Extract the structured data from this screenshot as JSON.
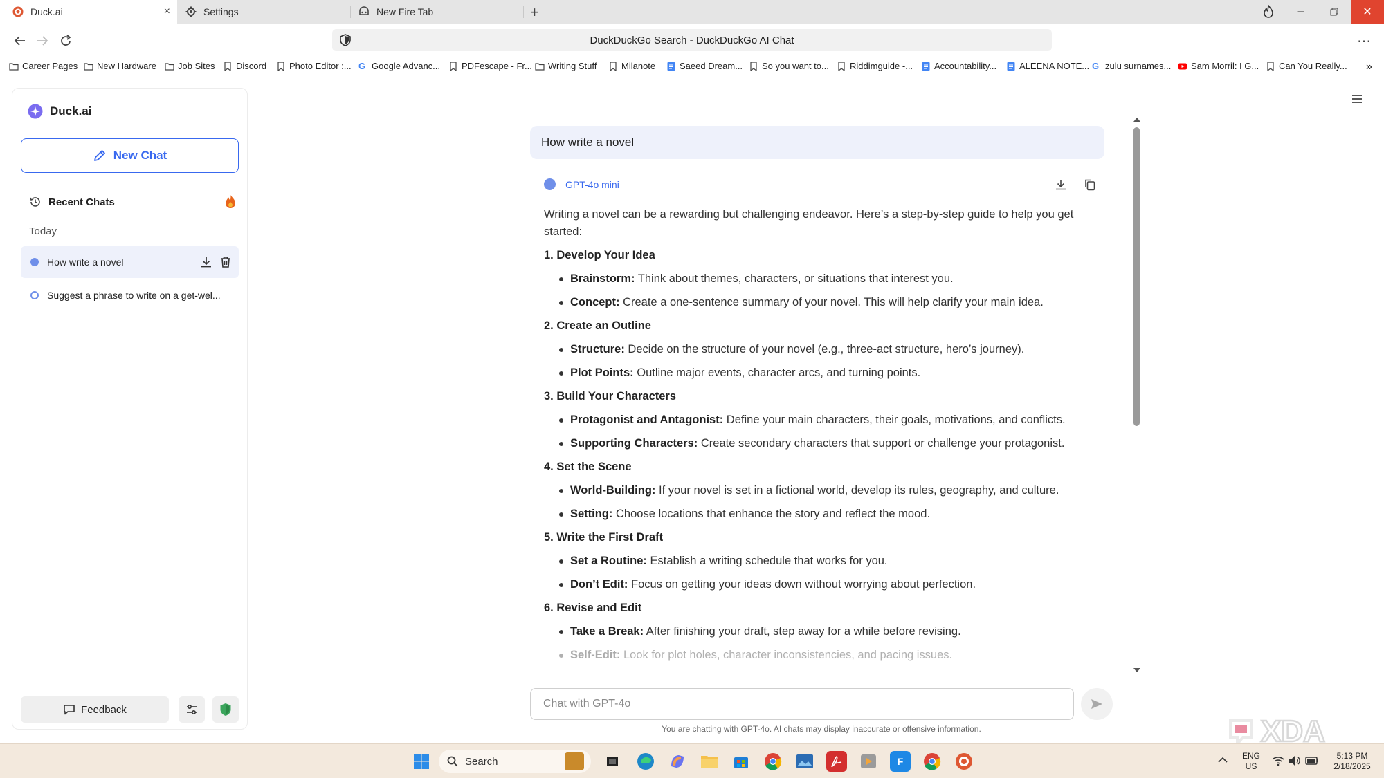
{
  "browser": {
    "tabs": [
      {
        "title": "Duck.ai",
        "active": true
      },
      {
        "title": "Settings",
        "active": false
      },
      {
        "title": "New Fire Tab",
        "active": false
      }
    ],
    "address": "DuckDuckGo Search - DuckDuckGo AI Chat",
    "bookmarks": [
      {
        "label": "Career Pages",
        "icon": "folder-icon"
      },
      {
        "label": "New Hardware",
        "icon": "folder-icon"
      },
      {
        "label": "Job Sites",
        "icon": "folder-icon"
      },
      {
        "label": "Discord",
        "icon": "bookmark-icon"
      },
      {
        "label": "Photo Editor :...",
        "icon": "bookmark-icon"
      },
      {
        "label": "Google Advanc...",
        "icon": "google-icon"
      },
      {
        "label": "PDFescape - Fr...",
        "icon": "bookmark-icon"
      },
      {
        "label": "Writing Stuff",
        "icon": "folder-icon"
      },
      {
        "label": "Milanote",
        "icon": "bookmark-icon"
      },
      {
        "label": "Saeed Dream...",
        "icon": "docs-icon"
      },
      {
        "label": "So you want to...",
        "icon": "bookmark-icon"
      },
      {
        "label": "Riddimguide -...",
        "icon": "bookmark-icon"
      },
      {
        "label": "Accountability...",
        "icon": "docs-icon"
      },
      {
        "label": "ALEENA NOTE...",
        "icon": "docs-icon"
      },
      {
        "label": "zulu surnames...",
        "icon": "google-icon"
      },
      {
        "label": "Sam Morril: I G...",
        "icon": "youtube-icon"
      },
      {
        "label": "Can You Really...",
        "icon": "bookmark-icon"
      }
    ]
  },
  "sidebar": {
    "brand": "Duck.ai",
    "new_chat": "New Chat",
    "recent_chats": "Recent Chats",
    "today": "Today",
    "chats": [
      {
        "title": "How write a novel",
        "selected": true
      },
      {
        "title": "Suggest a phrase to write on a get-wel...",
        "selected": false
      }
    ],
    "feedback": "Feedback"
  },
  "chat": {
    "user_message": "How write a novel",
    "model": "GPT-4o mini",
    "intro": "Writing a novel can be a rewarding but challenging endeavor. Here’s a step-by-step guide to help you get started:",
    "sections": [
      {
        "heading": "1. Develop Your Idea",
        "bullets": [
          {
            "term": "Brainstorm:",
            "text": " Think about themes, characters, or situations that interest you."
          },
          {
            "term": "Concept:",
            "text": " Create a one-sentence summary of your novel. This will help clarify your main idea."
          }
        ]
      },
      {
        "heading": "2. Create an Outline",
        "bullets": [
          {
            "term": "Structure:",
            "text": " Decide on the structure of your novel (e.g., three-act structure, hero’s journey)."
          },
          {
            "term": "Plot Points:",
            "text": " Outline major events, character arcs, and turning points."
          }
        ]
      },
      {
        "heading": "3. Build Your Characters",
        "bullets": [
          {
            "term": "Protagonist and Antagonist:",
            "text": " Define your main characters, their goals, motivations, and conflicts."
          },
          {
            "term": "Supporting Characters:",
            "text": " Create secondary characters that support or challenge your protagonist."
          }
        ]
      },
      {
        "heading": "4. Set the Scene",
        "bullets": [
          {
            "term": "World-Building:",
            "text": " If your novel is set in a fictional world, develop its rules, geography, and culture."
          },
          {
            "term": "Setting:",
            "text": " Choose locations that enhance the story and reflect the mood."
          }
        ]
      },
      {
        "heading": "5. Write the First Draft",
        "bullets": [
          {
            "term": "Set a Routine:",
            "text": " Establish a writing schedule that works for you."
          },
          {
            "term": "Don’t Edit:",
            "text": " Focus on getting your ideas down without worrying about perfection."
          }
        ]
      },
      {
        "heading": "6. Revise and Edit",
        "bullets": [
          {
            "term": "Take a Break:",
            "text": " After finishing your draft, step away for a while before revising."
          },
          {
            "term": "Self-Edit:",
            "text": " Look for plot holes, character inconsistencies, and pacing issues."
          }
        ]
      }
    ],
    "input_placeholder": "Chat with GPT-4o",
    "disclaimer": "You are chatting with GPT-4o. AI chats may display inaccurate or offensive information."
  },
  "taskbar": {
    "search": "Search",
    "lang_top": "ENG",
    "lang_bottom": "US",
    "time": "5:13 PM",
    "date": "2/18/2025"
  },
  "colors": {
    "accent": "#3969ef",
    "selected_bg": "#eef1fb",
    "close_button": "#e0442f",
    "taskbar": "#f3e9dd"
  }
}
